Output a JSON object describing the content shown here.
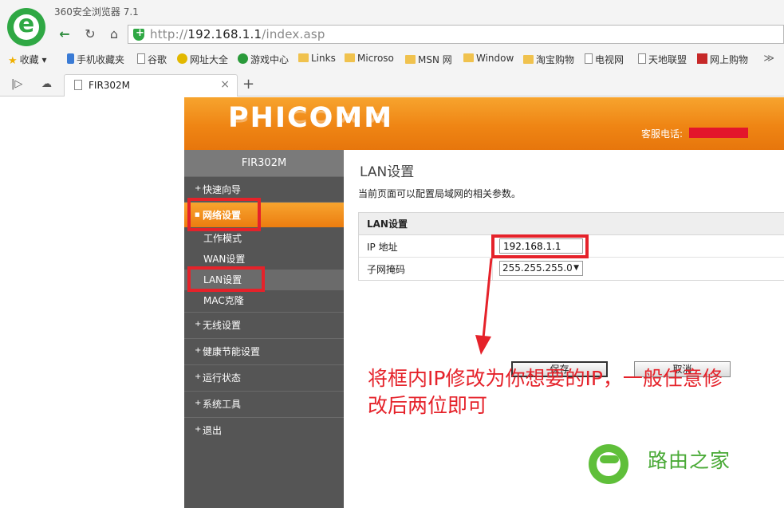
{
  "browser": {
    "title": "360安全浏览器 7.1",
    "url_prefix": "http://",
    "url_host": "192.168.1.1",
    "url_path": "/index.asp",
    "bookmarks": [
      {
        "label": "收藏",
        "icon": "star-icon"
      },
      {
        "label": "手机收藏夹",
        "icon": "phone-icon"
      },
      {
        "label": "谷歌",
        "icon": "page-icon"
      },
      {
        "label": "网址大全",
        "icon": "nav-icon"
      },
      {
        "label": "游戏中心",
        "icon": "game-icon"
      },
      {
        "label": "Links",
        "icon": "folder-icon"
      },
      {
        "label": "Microso",
        "icon": "folder-icon"
      },
      {
        "label": "MSN 网",
        "icon": "folder-icon"
      },
      {
        "label": "Window",
        "icon": "folder-icon"
      },
      {
        "label": "淘宝购物",
        "icon": "folder-icon"
      },
      {
        "label": "电视网",
        "icon": "page-icon"
      },
      {
        "label": "天地联盟",
        "icon": "page-icon"
      },
      {
        "label": "网上购物",
        "icon": "shop-icon"
      }
    ],
    "more": "≫",
    "tab_title": "FIR302M"
  },
  "router": {
    "brand": "PHICOMM",
    "hotline_label": "客服电话:",
    "model": "FIR302M",
    "menu": {
      "quick_guide": "快速向导",
      "network": "网络设置",
      "sub": {
        "work_mode": "工作模式",
        "wan": "WAN设置",
        "lan": "LAN设置",
        "mac": "MAC克隆"
      },
      "wireless": "无线设置",
      "health": "健康节能设置",
      "status": "运行状态",
      "tools": "系统工具",
      "logout": "退出"
    },
    "content": {
      "title": "LAN设置",
      "description": "当前页面可以配置局域网的相关参数。",
      "panel_title": "LAN设置",
      "ip_label": "IP 地址",
      "ip_value": "192.168.1.1",
      "mask_label": "子网掩码",
      "mask_value": "255.255.255.0",
      "save": "保存",
      "cancel": "取消"
    }
  },
  "annotation": {
    "text": "将框内IP修改为你想要的IP，一般任意修改后两位即可",
    "color": "#e5222a"
  },
  "watermark": {
    "text": "路由之家"
  }
}
